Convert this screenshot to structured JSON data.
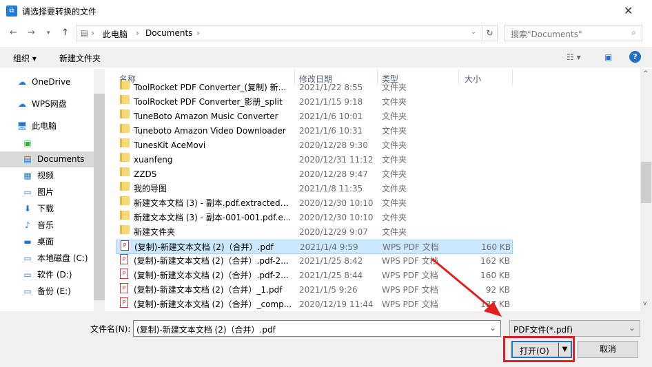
{
  "window": {
    "title": "请选择要转换的文件"
  },
  "address": {
    "segments": [
      "此电脑",
      "Documents"
    ],
    "search_placeholder": "搜索\"Documents\""
  },
  "toolbar": {
    "organize": "组织",
    "new_folder": "新建文件夹"
  },
  "sidebar": {
    "items": [
      {
        "label": "OneDrive",
        "icon": "cloud-icon"
      },
      {
        "label": "WPS网盘",
        "icon": "wps-cloud-icon"
      },
      {
        "label": "此电脑",
        "icon": "computer-icon"
      },
      {
        "label": "",
        "icon": "green-app-icon"
      },
      {
        "label": "Documents",
        "icon": "document-icon",
        "selected": true
      },
      {
        "label": "视频",
        "icon": "video-icon"
      },
      {
        "label": "图片",
        "icon": "picture-icon"
      },
      {
        "label": "下载",
        "icon": "download-icon"
      },
      {
        "label": "音乐",
        "icon": "music-icon"
      },
      {
        "label": "桌面",
        "icon": "desktop-icon"
      },
      {
        "label": "本地磁盘 (C:)",
        "icon": "drive-icon"
      },
      {
        "label": "软件 (D:)",
        "icon": "drive-icon"
      },
      {
        "label": "备份 (E:)",
        "icon": "drive-icon"
      }
    ]
  },
  "columns": {
    "name": "名称",
    "date": "修改日期",
    "type": "类型",
    "size": "大小"
  },
  "files": [
    {
      "name": "ToolRocket PDF Converter_(复制) 新...",
      "date": "2021/1/22 8:55",
      "type": "文件夹",
      "size": "",
      "kind": "folder"
    },
    {
      "name": "ToolRocket PDF Converter_影册_split",
      "date": "2021/1/15 9:18",
      "type": "文件夹",
      "size": "",
      "kind": "folder"
    },
    {
      "name": "TuneBoto Amazon Music Converter",
      "date": "2021/1/6 10:01",
      "type": "文件夹",
      "size": "",
      "kind": "folder"
    },
    {
      "name": "Tuneboto Amazon Video Downloader",
      "date": "2021/1/6 10:31",
      "type": "文件夹",
      "size": "",
      "kind": "folder"
    },
    {
      "name": "TunesKit AceMovi",
      "date": "2020/12/28 9:30",
      "type": "文件夹",
      "size": "",
      "kind": "folder"
    },
    {
      "name": "xuanfeng",
      "date": "2020/12/31 11:12",
      "type": "文件夹",
      "size": "",
      "kind": "folder"
    },
    {
      "name": "ZZDS",
      "date": "2020/12/28 9:47",
      "type": "文件夹",
      "size": "",
      "kind": "folder"
    },
    {
      "name": "我的导图",
      "date": "2021/1/8 11:35",
      "type": "文件夹",
      "size": "",
      "kind": "folder"
    },
    {
      "name": "新建文本文档 (3) - 副本.pdf.extracted_i...",
      "date": "2020/12/30 10:10",
      "type": "文件夹",
      "size": "",
      "kind": "folder"
    },
    {
      "name": "新建文本文档 (3) - 副本-001-001.pdf.e...",
      "date": "2020/12/30 10:10",
      "type": "文件夹",
      "size": "",
      "kind": "folder"
    },
    {
      "name": "新建文件夹",
      "date": "2020/12/29 9:07",
      "type": "文件夹",
      "size": "",
      "kind": "folder"
    },
    {
      "name": "(复制)-新建文本文档 (2)（合并）.pdf",
      "date": "2021/1/4 9:59",
      "type": "WPS PDF 文档",
      "size": "160 KB",
      "kind": "pdf",
      "selected": true
    },
    {
      "name": "(复制)-新建文本文档 (2)（合并）.pdf-2...",
      "date": "2021/1/25 8:42",
      "type": "WPS PDF 文档",
      "size": "162 KB",
      "kind": "pdf"
    },
    {
      "name": "(复制)-新建文本文档 (2)（合并）.pdf-2...",
      "date": "2021/1/25 8:44",
      "type": "WPS PDF 文档",
      "size": "160 KB",
      "kind": "pdf"
    },
    {
      "name": "(复制)-新建文本文档 (2)（合并）_1.pdf",
      "date": "2021/1/5 9:26",
      "type": "WPS PDF 文档",
      "size": "92 KB",
      "kind": "pdf"
    },
    {
      "name": "(复制)-新建文本文档 (2)（合并）_comp...",
      "date": "2020/12/19 11:44",
      "type": "WPS PDF 文档",
      "size": "137 KB",
      "kind": "pdf"
    }
  ],
  "footer": {
    "filename_label": "文件名(N):",
    "filename_value": "(复制)-新建文本文档 (2)（合并）.pdf",
    "filter": "PDF文件(*.pdf)",
    "open": "打开(O)",
    "cancel": "取消"
  },
  "colors": {
    "accent": "#1878c8",
    "highlight": "#e02020",
    "selection": "#cce8ff"
  }
}
